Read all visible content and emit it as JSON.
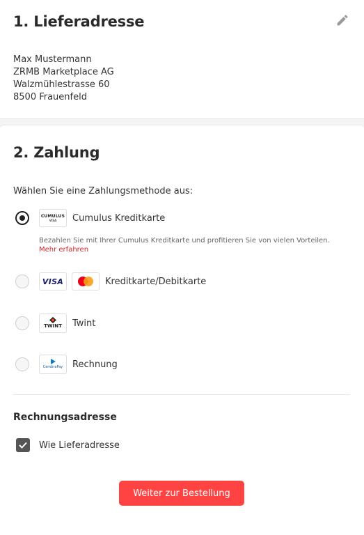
{
  "delivery": {
    "title": "1. Lieferadresse",
    "edit_icon": "pencil-icon",
    "address": {
      "name": "Max Mustermann",
      "company": "ZRMB Marketplace AG",
      "street": "Walzmühlestrasse 60",
      "city": "8500 Frauenfeld"
    }
  },
  "payment": {
    "title": "2. Zahlung",
    "prompt": "Wählen Sie eine Zahlungsmethode aus:",
    "options": [
      {
        "label": "Cumulus Kreditkarte",
        "logo_text": "CUMULUS",
        "logo_subtext": "VISA",
        "selected": true,
        "description": "Bezahlen Sie mit Ihrer Cumulus Kreditkarte und profitieren Sie von vielen Vorteilen.",
        "more_link": "Mehr erfahren"
      },
      {
        "label": "Kreditkarte/Debitkarte",
        "logo_text": "VISA",
        "selected": false
      },
      {
        "label": "Twint",
        "logo_text": "TWINT",
        "selected": false
      },
      {
        "label": "Rechnung",
        "logo_text": "CembraPay",
        "selected": false
      }
    ]
  },
  "billing": {
    "title": "Rechnungsadresse",
    "same_as_delivery_label": "Wie Lieferadresse",
    "same_as_delivery_checked": true
  },
  "submit": {
    "label": "Weiter zur Bestellung"
  },
  "colors": {
    "accent": "#ff4343",
    "link": "#d8232a",
    "visa_blue": "#1a1f71",
    "mastercard_red": "#eb001b",
    "mastercard_orange": "#f79e1b"
  }
}
